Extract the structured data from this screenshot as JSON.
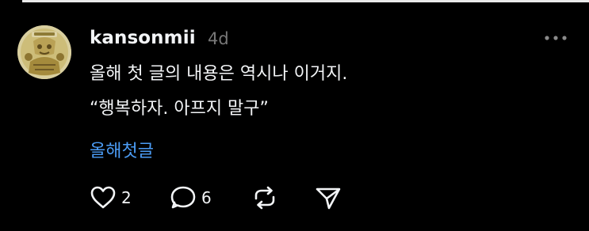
{
  "post": {
    "username": "kansonmii",
    "timestamp": "4d",
    "lines": [
      "올해 첫 글의 내용은 역시나 이거지.",
      "“행복하자. 아프지 말구”"
    ],
    "hashtag": "올해첫글"
  },
  "actions": {
    "like_count": "2",
    "reply_count": "6"
  },
  "icons": {
    "more": "more-dots-icon",
    "like": "heart-icon",
    "reply": "speech-bubble-icon",
    "repost": "repost-icon",
    "share": "send-icon"
  },
  "colors": {
    "background": "#000000",
    "text": "#f3f5f7",
    "muted": "#777777",
    "hashtag": "#4b9cf5"
  }
}
